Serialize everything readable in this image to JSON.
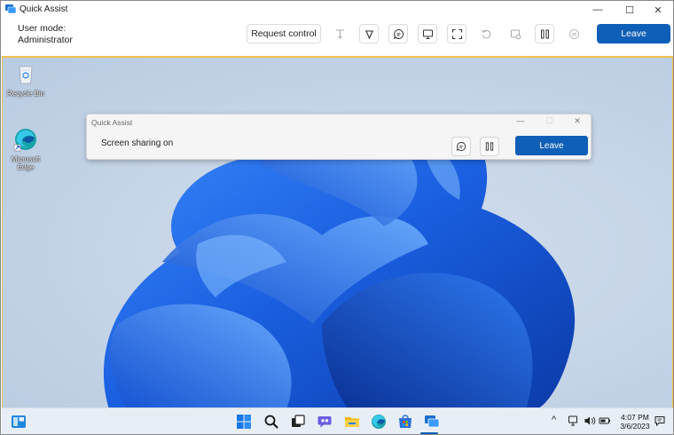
{
  "window": {
    "title": "Quick Assist",
    "controls": {
      "minimize": "—",
      "maximize": "☐",
      "close": "✕"
    }
  },
  "toolbar": {
    "user_mode_label": "User mode:",
    "user_mode_value": "Administrator",
    "request_control_label": "Request control",
    "leave_label": "Leave",
    "tools": [
      "laser-pointer-icon",
      "annotate-icon",
      "chat-icon",
      "switch-monitor-icon",
      "fullscreen-icon",
      "restart-icon",
      "task-manager-icon",
      "pause-icon",
      "stop-icon"
    ]
  },
  "desktop": {
    "icons": [
      {
        "label_line1": "Recycle Bin",
        "label_line2": "",
        "icon": "recycle-bin-icon"
      },
      {
        "label_line1": "Microsoft",
        "label_line2": "Edge",
        "icon": "edge-icon"
      }
    ]
  },
  "mini_window": {
    "title": "Quick Assist",
    "status": "Screen sharing on",
    "leave_label": "Leave",
    "controls": {
      "minimize": "—",
      "maximize": "☐",
      "close": "✕"
    }
  },
  "taskbar": {
    "icons": [
      "widgets-icon",
      "start-icon",
      "search-icon",
      "task-view-icon",
      "teams-chat-icon",
      "file-explorer-icon",
      "edge-icon",
      "store-icon",
      "quick-assist-icon"
    ],
    "tray": {
      "chevron": "^"
    },
    "time": "4:07 PM",
    "date": "3/6/2023"
  },
  "colors": {
    "accent": "#0f5fb8",
    "frame": "#f2c14e",
    "bloom": "#1e6ee8"
  }
}
